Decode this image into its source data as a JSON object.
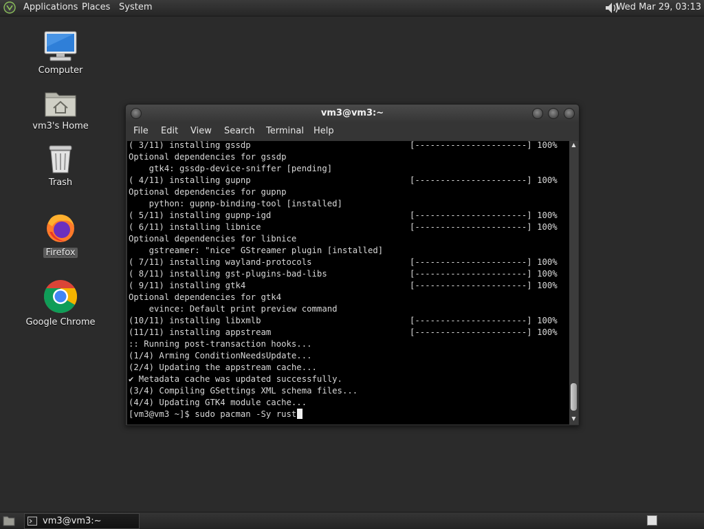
{
  "top_panel": {
    "menus": [
      "Applications",
      "Places",
      "System"
    ],
    "clock": "Wed Mar 29, 03:13"
  },
  "desktop_icons": [
    {
      "label": "Computer"
    },
    {
      "label": "vm3's Home"
    },
    {
      "label": "Trash"
    },
    {
      "label": "Firefox"
    },
    {
      "label": "Google Chrome"
    }
  ],
  "terminal": {
    "title": "vm3@vm3:~",
    "menu": [
      "File",
      "Edit",
      "View",
      "Search",
      "Terminal",
      "Help"
    ],
    "progress_bar": "[----------------------] 100%",
    "lines": [
      {
        "text": "( 3/11) installing gssdp",
        "bar": true
      },
      {
        "text": "Optional dependencies for gssdp",
        "bar": false
      },
      {
        "text": "    gtk4: gssdp-device-sniffer [pending]",
        "bar": false
      },
      {
        "text": "( 4/11) installing gupnp",
        "bar": true
      },
      {
        "text": "Optional dependencies for gupnp",
        "bar": false
      },
      {
        "text": "    python: gupnp-binding-tool [installed]",
        "bar": false
      },
      {
        "text": "( 5/11) installing gupnp-igd",
        "bar": true
      },
      {
        "text": "( 6/11) installing libnice",
        "bar": true
      },
      {
        "text": "Optional dependencies for libnice",
        "bar": false
      },
      {
        "text": "    gstreamer: \"nice\" GStreamer plugin [installed]",
        "bar": false
      },
      {
        "text": "( 7/11) installing wayland-protocols",
        "bar": true
      },
      {
        "text": "( 8/11) installing gst-plugins-bad-libs",
        "bar": true
      },
      {
        "text": "( 9/11) installing gtk4",
        "bar": true
      },
      {
        "text": "Optional dependencies for gtk4",
        "bar": false
      },
      {
        "text": "    evince: Default print preview command",
        "bar": false
      },
      {
        "text": "(10/11) installing libxmlb",
        "bar": true
      },
      {
        "text": "(11/11) installing appstream",
        "bar": true
      },
      {
        "text": ":: Running post-transaction hooks...",
        "bar": false
      },
      {
        "text": "(1/4) Arming ConditionNeedsUpdate...",
        "bar": false
      },
      {
        "text": "(2/4) Updating the appstream cache...",
        "bar": false
      },
      {
        "text": "✔ Metadata cache was updated successfully.",
        "bar": false
      },
      {
        "text": "(3/4) Compiling GSettings XML schema files...",
        "bar": false
      },
      {
        "text": "(4/4) Updating GTK4 module cache...",
        "bar": false
      }
    ],
    "prompt": "[vm3@vm3 ~]$",
    "command": " sudo pacman -Sy rust"
  },
  "taskbar": {
    "task_label": "vm3@vm3:~"
  }
}
